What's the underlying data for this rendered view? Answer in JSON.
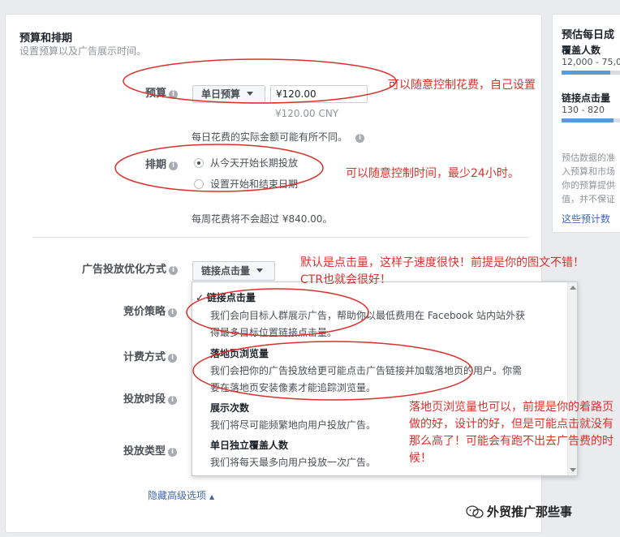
{
  "section": {
    "title": "预算和排期",
    "subtitle": "设置预算以及广告展示时间。"
  },
  "budget": {
    "label": "预算",
    "type_button": "单日预算",
    "amount_value": "¥120.00",
    "amount_cny": "¥120.00 CNY",
    "note": "每日花费的实际金额可能有所不同。"
  },
  "schedule": {
    "label": "排期",
    "options": [
      "从今天开始长期投放",
      "设置开始和结束日期"
    ],
    "weekly_note": "每周花费将不会超过 ¥840.00。"
  },
  "optimization": {
    "label": "广告投放优化方式",
    "selected": "链接点击量"
  },
  "left_labels": [
    "竞价策略",
    "计费方式",
    "投放时段",
    "投放类型"
  ],
  "dropdown": {
    "options": [
      {
        "title": "链接点击量",
        "checked": true,
        "desc1": "我们会向目标人群展示广告，帮助你以最低费用在 Facebook 站内站外获",
        "desc2": "得最多目标位置链接点击量。"
      },
      {
        "title": "落地页浏览量",
        "checked": false,
        "desc1": "我们会把你的广告投放给更可能点击广告链接并加载落地页的用户。你需",
        "desc2": "要在落地页安装像素才能追踪浏览量。"
      },
      {
        "title": "展示次数",
        "checked": false,
        "desc1": "我们将尽可能频繁地向用户投放广告。",
        "desc2": ""
      },
      {
        "title": "单日独立覆盖人数",
        "checked": false,
        "desc1": "我们将每天最多向用户投放一次广告。",
        "desc2": ""
      }
    ]
  },
  "hide_advanced": "隐藏高级选项",
  "right_panel": {
    "title": "预估每日成",
    "reach_label": "覆盖人数",
    "reach_value": "12,000 - 75,0",
    "reach_fill": 0.75,
    "clicks_label": "链接点击量",
    "clicks_value": "130 - 820",
    "clicks_fill": 0.8,
    "desc_lines": [
      "预估数据的准",
      "入预算和市场",
      "你的预算提供",
      "值，并不保证"
    ],
    "link": "这些预计数"
  },
  "annotations": {
    "a1": "可以随意控制花费，自己设置",
    "a2": "可以随意控制时间，最少24小时。",
    "a3": "默认是点击量，这样子速度很快！前提是你的图文不错！CTR也就会很好！",
    "a4": "落地页浏览量也可以，前提是你的着路页做的好，设计的好，但是可能点击就没有那么高了！可能会有跑不出去广告费的时候！"
  },
  "watermark": "外贸推广那些事",
  "colors": {
    "annotation": "#d9312b",
    "link": "#4267b2",
    "bar": "#5b9bd5"
  }
}
